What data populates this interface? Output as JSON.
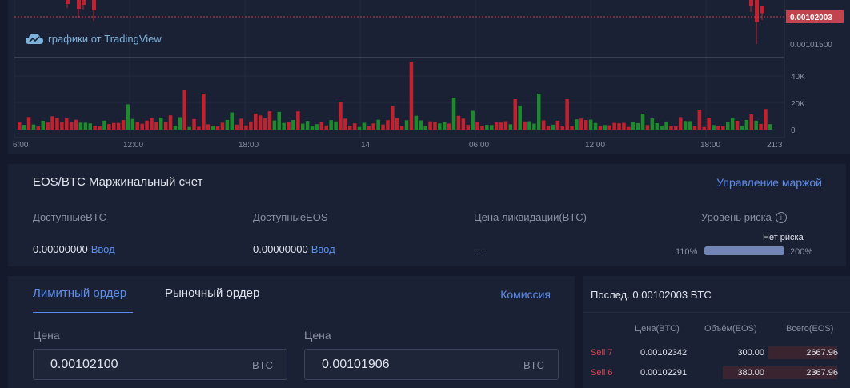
{
  "chart": {
    "watermark_text": "графики от TradingView",
    "price_label": "0.00102003",
    "price_axis_tick": "0.00101500",
    "volume_ticks": [
      "40K",
      "20K",
      "0"
    ],
    "time_ticks": [
      "6:00",
      "12:00",
      "18:00",
      "14",
      "06:00",
      "12:00",
      "18:00",
      "21:3"
    ],
    "colors": {
      "up": "#1e8a2e",
      "down": "#c0232f",
      "price_line": "#c0434d"
    }
  },
  "margin_account": {
    "title": "EOS/BTC Маржинальный счет",
    "manage_link": "Управление маржой",
    "available_btc": {
      "label": "ДоступныеBTC",
      "value": "0.00000000",
      "link": "Ввод"
    },
    "available_eos": {
      "label": "ДоступныеEOS",
      "value": "0.00000000",
      "link": "Ввод"
    },
    "liquidation": {
      "label": "Цена ликвидации(BTC)",
      "value": "---"
    },
    "risk": {
      "label": "Уровень риска",
      "status": "Нет риска",
      "min": "110%",
      "max": "200%"
    }
  },
  "order_form": {
    "tabs": [
      "Лимитный ордер",
      "Рыночный ордер"
    ],
    "commission_link": "Комиссия",
    "fields": [
      {
        "label": "Цена",
        "value": "0.00102100",
        "unit": "BTC"
      },
      {
        "label": "Цена",
        "value": "0.00101906",
        "unit": "BTC"
      }
    ]
  },
  "order_book": {
    "last_price": "Послед. 0.00102003 BTC",
    "headers": [
      "Цена(BTC)",
      "Объём(EOS)",
      "Всего(EOS)"
    ],
    "rows": [
      {
        "side": "Sell 7",
        "price": "0.00102342",
        "volume": "300.00",
        "total": "2667.96",
        "depth_fraction": 0.27
      },
      {
        "side": "Sell 6",
        "price": "0.00102291",
        "volume": "380.00",
        "total": "2367.96",
        "depth_fraction": 0.45
      }
    ]
  }
}
